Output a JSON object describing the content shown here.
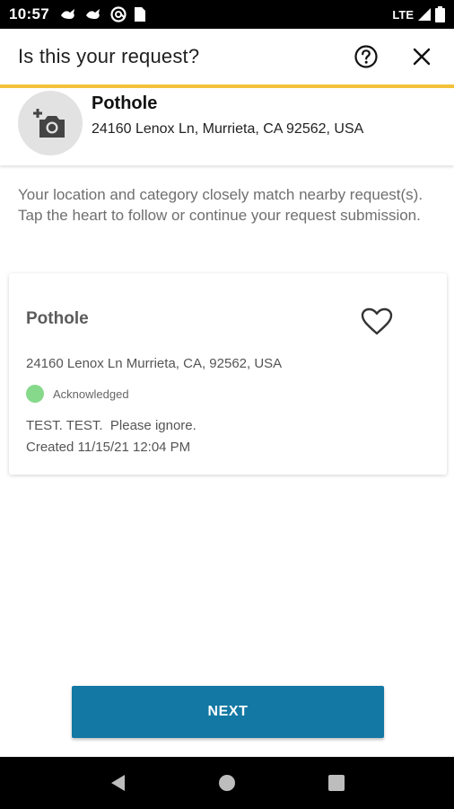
{
  "status_bar": {
    "time": "10:57",
    "network": "LTE",
    "notification_icons": [
      "bird-icon",
      "bird-icon",
      "at-icon",
      "sim-card-icon"
    ],
    "right_icons": [
      "signal-icon",
      "battery-icon"
    ]
  },
  "header": {
    "title": "Is this your request?",
    "accent_color": "#f3c13a",
    "actions": [
      "help-circle-icon",
      "close-icon"
    ]
  },
  "selected_request": {
    "photo_icon": "add-photo-icon",
    "category": "Pothole",
    "address": "24160 Lenox Ln, Murrieta, CA 92562, USA"
  },
  "message": "Your location and category closely match nearby request(s). Tap the heart to follow or continue your request submission.",
  "matches": [
    {
      "category": "Pothole",
      "address": "24160 Lenox Ln Murrieta, CA, 92562, USA",
      "status": "Acknowledged",
      "status_color": "#86d98b",
      "description": "TEST. TEST.  Please ignore.",
      "created": "Created 11/15/21 12:04 PM",
      "follow_icon": "heart-outline-icon"
    }
  ],
  "next_button": {
    "label": "NEXT",
    "color": "#1378a3"
  },
  "nav_bar": {
    "buttons": [
      "back-triangle-icon",
      "home-circle-icon",
      "recents-square-icon"
    ]
  }
}
